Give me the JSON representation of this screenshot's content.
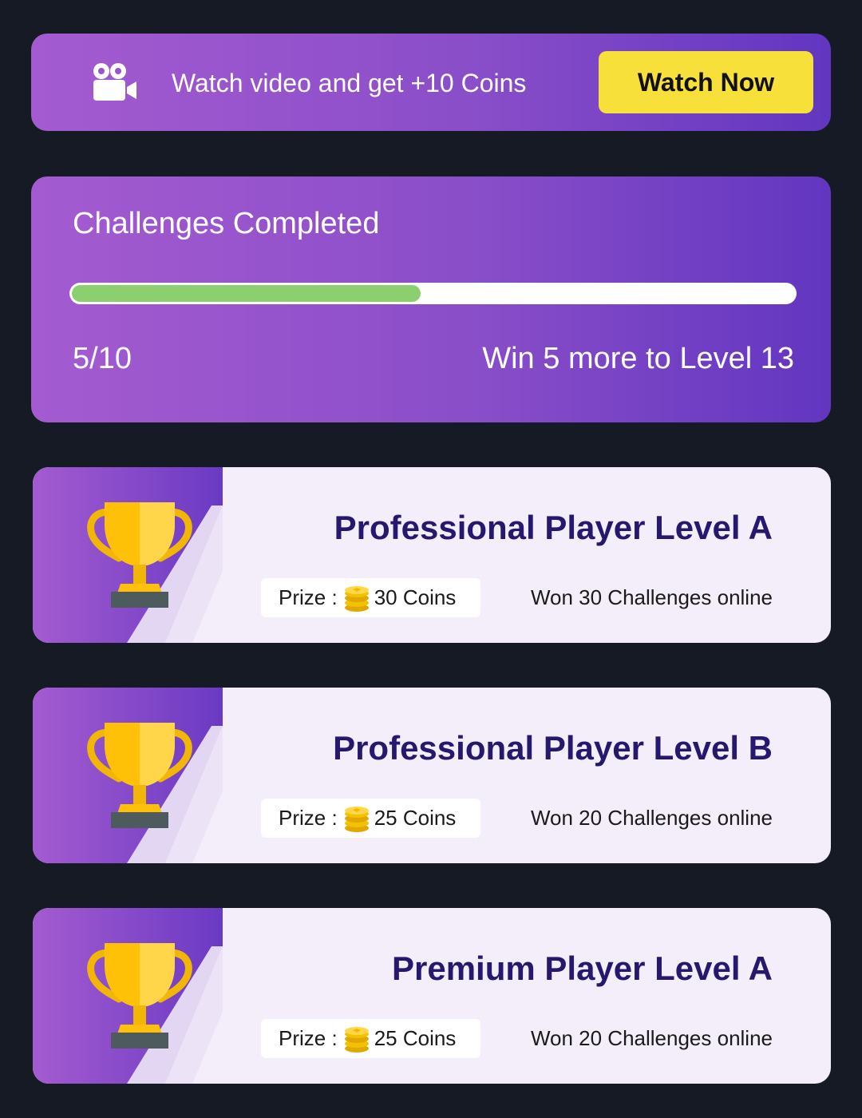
{
  "watch_banner": {
    "icon": "video-camera-icon",
    "text": "Watch video and get +10 Coins",
    "button_label": "Watch Now"
  },
  "progress": {
    "title": "Challenges Completed",
    "count_label": "5/10",
    "completed": 5,
    "total": 10,
    "fraction": 0.5,
    "next_label": "Win 5 more to Level 13"
  },
  "levels": [
    {
      "title": "Professional Player Level A",
      "prize_prefix": "Prize :",
      "prize_amount": "30 Coins",
      "requirement": "Won 30 Challenges online"
    },
    {
      "title": "Professional Player Level B",
      "prize_prefix": "Prize :",
      "prize_amount": "25 Coins",
      "requirement": "Won 20 Challenges online"
    },
    {
      "title": "Premium Player Level A",
      "prize_prefix": "Prize :",
      "prize_amount": "25 Coins",
      "requirement": "Won 20 Challenges online"
    }
  ],
  "icons": {
    "trophy": "trophy-icon",
    "coin": "coin-stack-icon"
  },
  "colors": {
    "background": "#151a24",
    "banner_gradient_start": "#a45bd0",
    "banner_gradient_end": "#6236c0",
    "button_yellow": "#f8e03a",
    "progress_green": "#8ccf6e",
    "card_background": "#f3eef9",
    "title_navy": "#26186e",
    "trophy_gold": "#ffc107"
  }
}
